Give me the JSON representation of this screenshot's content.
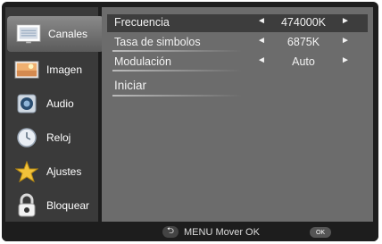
{
  "sidebar": {
    "items": [
      {
        "label": "Canales",
        "icon": "tv-channels-icon",
        "active": true
      },
      {
        "label": "Imagen",
        "icon": "picture-icon"
      },
      {
        "label": "Audio",
        "icon": "speaker-icon"
      },
      {
        "label": "Reloj",
        "icon": "clock-icon"
      },
      {
        "label": "Ajustes",
        "icon": "star-settings-icon"
      },
      {
        "label": "Bloquear",
        "icon": "padlock-icon"
      }
    ]
  },
  "settings": {
    "rows": [
      {
        "label": "Frecuencia",
        "value": "474000K",
        "selected": true
      },
      {
        "label": "Tasa de simbolos",
        "value": "6875K"
      },
      {
        "label": "Modulación",
        "value": "Auto"
      },
      {
        "label": "Iniciar"
      }
    ]
  },
  "footer": {
    "hint": "MENU Mover OK",
    "ok_button": "OK"
  },
  "colors": {
    "background": "#1d1d1d",
    "sidebar": "#3a3a3a",
    "panel": "#6c6c6c",
    "selected_row": "#3d3d3d",
    "text": "#ffffff"
  }
}
